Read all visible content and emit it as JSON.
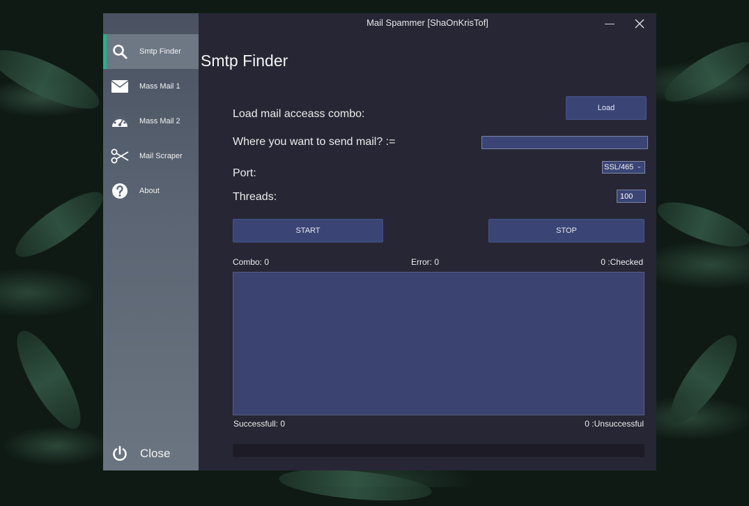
{
  "window": {
    "title": "Mail Spammer [ShaOnKrisTof]",
    "minimize_label": "—"
  },
  "sidebar": {
    "items": [
      {
        "label": "Smtp Finder",
        "icon": "search-icon"
      },
      {
        "label": "Mass Mail 1",
        "icon": "envelope-icon"
      },
      {
        "label": "Mass Mail 2",
        "icon": "gauge-icon"
      },
      {
        "label": "Mail Scraper",
        "icon": "scissors-icon"
      },
      {
        "label": "About",
        "icon": "question-icon"
      }
    ],
    "close_label": "Close"
  },
  "main": {
    "page_title": "Smtp Finder",
    "load_combo_label": "Load mail acceass combo:",
    "load_button": "Load",
    "send_to_label": "Where you want to send mail? :=",
    "send_to_value": "",
    "port_label": "Port:",
    "port_selected": "SSL/465",
    "threads_label": "Threads:",
    "threads_value": "100",
    "start_button": "START",
    "stop_button": "STOP",
    "combo_stat": "Combo: 0",
    "error_stat": "Error: 0",
    "checked_stat": "0 :Checked",
    "successful_stat": "Successfull: 0",
    "unsuccessful_stat": "0 :Unsuccessful",
    "progress": 0
  },
  "colors": {
    "accent": "#1fb58a",
    "button": "#3b4575",
    "window_bg": "#272634"
  }
}
